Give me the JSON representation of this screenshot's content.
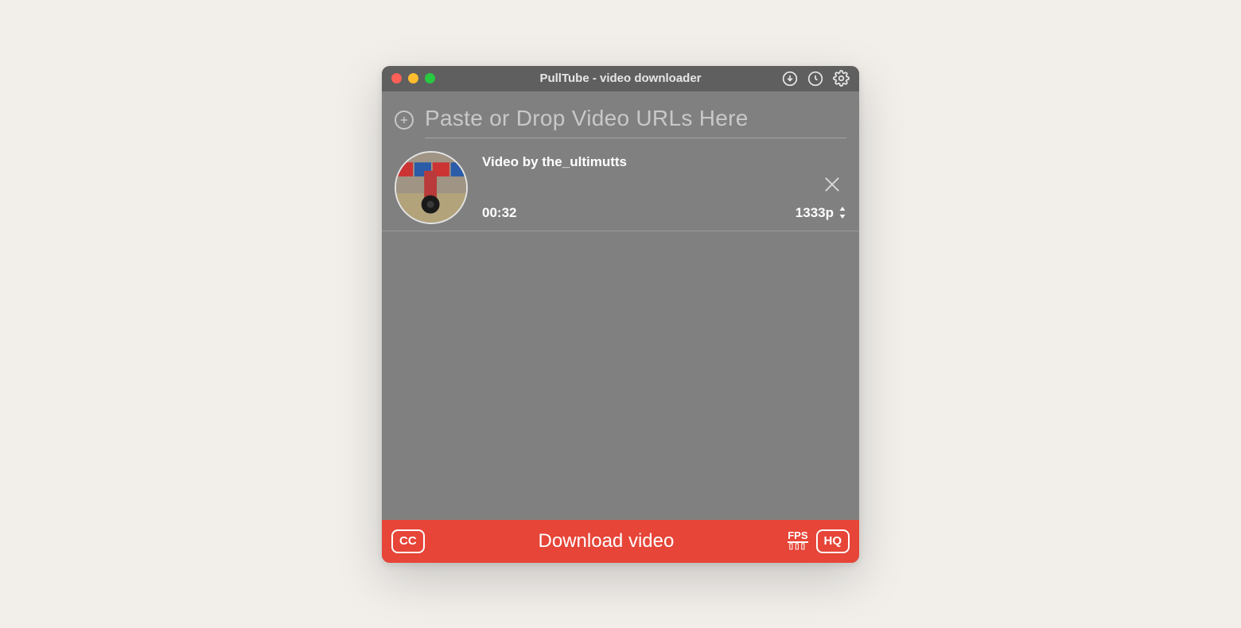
{
  "window": {
    "title": "PullTube - video downloader"
  },
  "url": {
    "placeholder": "Paste or Drop Video URLs Here",
    "value": ""
  },
  "item": {
    "title": "Video by the_ultimutts",
    "duration": "00:32",
    "quality": "1333p"
  },
  "footer": {
    "cc": "CC",
    "download": "Download video",
    "fps": "FPS",
    "hq": "HQ"
  }
}
